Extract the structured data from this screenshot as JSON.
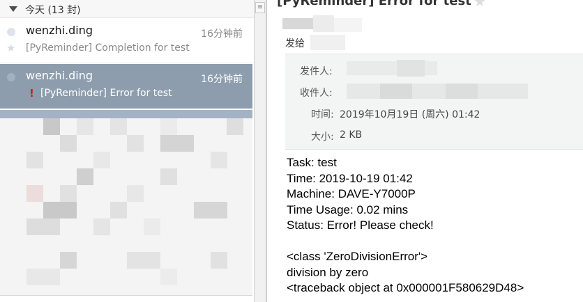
{
  "list": {
    "group_label": "今天 (13 封)",
    "mails": [
      {
        "sender": "wenzhi.ding",
        "time": "16分钟前",
        "subject": "[PyReminder] Completion for test",
        "selected": false,
        "flagged": false
      },
      {
        "sender": "wenzhi.ding",
        "time": "16分钟前",
        "subject": "[PyReminder] Error for test",
        "selected": true,
        "flagged": true
      }
    ],
    "icons": {
      "group_toggle": "triangle-down-icon",
      "unread_dot": "dot-icon",
      "star": "star-icon",
      "flag": "exclamation-icon"
    },
    "selected_color": "#8d9dae",
    "flag_color": "#cc1a1a"
  },
  "splitter": {
    "handle_glyph": "≡",
    "icon": "menu-icon"
  },
  "reader": {
    "title": "[PyReminder] Error for test",
    "title_star_glyph": "★",
    "recipient_prefix": "发给",
    "header": {
      "from_label": "发件人:",
      "to_label": "收件人:",
      "time_label": "时间:",
      "time_value": "2019年10月19日 (周六) 01:42",
      "size_label": "大小:",
      "size_value": "2 KB"
    },
    "body_lines": [
      "Task: test",
      "Time: 2019-10-19 01:42",
      "Machine: DAVE-Y7000P",
      "Time Usage: 0.02 mins",
      "Status: Error! Please check!",
      "",
      "<class 'ZeroDivisionError'>",
      "division by zero",
      "<traceback object at 0x000001F580629D48>"
    ]
  }
}
